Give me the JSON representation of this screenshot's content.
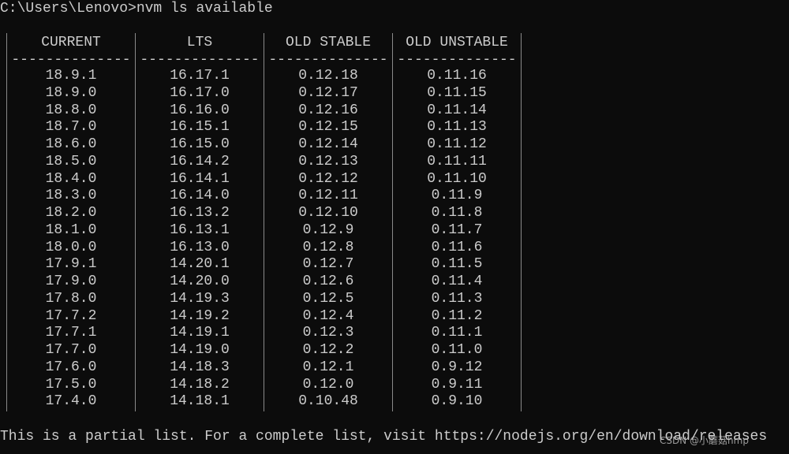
{
  "terminal": {
    "prompt": "C:\\Users\\Lenovo>",
    "command": "nvm ls available",
    "rule": "--------------",
    "columns": [
      {
        "header": "CURRENT",
        "values": [
          "18.9.1",
          "18.9.0",
          "18.8.0",
          "18.7.0",
          "18.6.0",
          "18.5.0",
          "18.4.0",
          "18.3.0",
          "18.2.0",
          "18.1.0",
          "18.0.0",
          "17.9.1",
          "17.9.0",
          "17.8.0",
          "17.7.2",
          "17.7.1",
          "17.7.0",
          "17.6.0",
          "17.5.0",
          "17.4.0"
        ]
      },
      {
        "header": "LTS",
        "values": [
          "16.17.1",
          "16.17.0",
          "16.16.0",
          "16.15.1",
          "16.15.0",
          "16.14.2",
          "16.14.1",
          "16.14.0",
          "16.13.2",
          "16.13.1",
          "16.13.0",
          "14.20.1",
          "14.20.0",
          "14.19.3",
          "14.19.2",
          "14.19.1",
          "14.19.0",
          "14.18.3",
          "14.18.2",
          "14.18.1"
        ]
      },
      {
        "header": "OLD STABLE",
        "values": [
          "0.12.18",
          "0.12.17",
          "0.12.16",
          "0.12.15",
          "0.12.14",
          "0.12.13",
          "0.12.12",
          "0.12.11",
          "0.12.10",
          "0.12.9",
          "0.12.8",
          "0.12.7",
          "0.12.6",
          "0.12.5",
          "0.12.4",
          "0.12.3",
          "0.12.2",
          "0.12.1",
          "0.12.0",
          "0.10.48"
        ]
      },
      {
        "header": "OLD UNSTABLE",
        "values": [
          "0.11.16",
          "0.11.15",
          "0.11.14",
          "0.11.13",
          "0.11.12",
          "0.11.11",
          "0.11.10",
          "0.11.9",
          "0.11.8",
          "0.11.7",
          "0.11.6",
          "0.11.5",
          "0.11.4",
          "0.11.3",
          "0.11.2",
          "0.11.1",
          "0.11.0",
          "0.9.12",
          "0.9.11",
          "0.9.10"
        ]
      }
    ],
    "footer": "This is a partial list. For a complete list, visit https://nodejs.org/en/download/releases",
    "watermark": "CSDN @小蘑菇hmp"
  },
  "colors": {
    "background": "#0c0c0c",
    "text": "#cccccc"
  }
}
